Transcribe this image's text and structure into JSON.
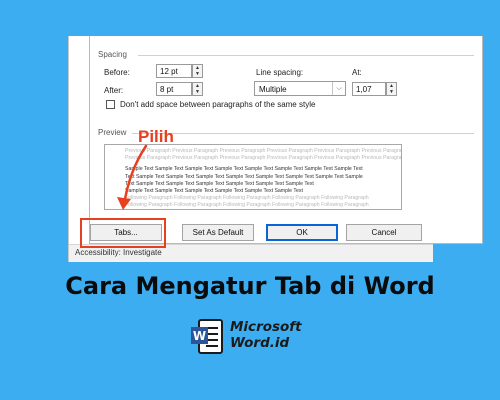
{
  "dialog": {
    "spacing_label": "Spacing",
    "before_label": "Before:",
    "before_value": "12 pt",
    "after_label": "After:",
    "after_value": "8 pt",
    "line_spacing_label": "Line spacing:",
    "line_spacing_value": "Multiple",
    "at_label": "At:",
    "at_value": "1,07",
    "dont_add_space_label": "Don't add space between paragraphs of the same style",
    "preview_label": "Preview",
    "preview_previous_lines": [
      "Previous Paragraph Previous Paragraph Previous Paragraph Previous Paragraph Previous Paragraph Previous Paragraph",
      "Previous Paragraph Previous Paragraph Previous Paragraph Previous Paragraph Previous Paragraph Previous Paragraph"
    ],
    "preview_sample_lines": [
      "Sample Text Sample Text Sample Text Sample Text Sample Text Sample Text Sample Text Sample Text",
      "Text Sample Text Sample Text Sample Text Sample Text Sample Text Sample Text Sample Text Sample",
      "Text Sample Text Sample Text Sample Text Sample Text Sample Text Sample Text",
      "Sample Text Sample Text Sample Text Sample Text Sample Text Sample Text"
    ],
    "preview_following_lines": [
      "Following Paragraph Following Paragraph Following Paragraph Following Paragraph Following Paragraph",
      "Following Paragraph Following Paragraph Following Paragraph Following Paragraph Following Paragraph"
    ],
    "tabs_button": "Tabs...",
    "set_default_button": "Set As Default",
    "ok_button": "OK",
    "cancel_button": "Cancel"
  },
  "status_bar": {
    "accessibility": "Accessibility: Investigate"
  },
  "annotation": {
    "callout": "Pilih"
  },
  "headline": "Cara Mengatur Tab di Word",
  "logo": {
    "line1": "Microsoft",
    "line2": "Word.id",
    "badge": "W"
  },
  "colors": {
    "background": "#3dadf2",
    "highlight": "#e5401f",
    "ok_border": "#0a64d6",
    "logo_blue": "#2b579a"
  }
}
